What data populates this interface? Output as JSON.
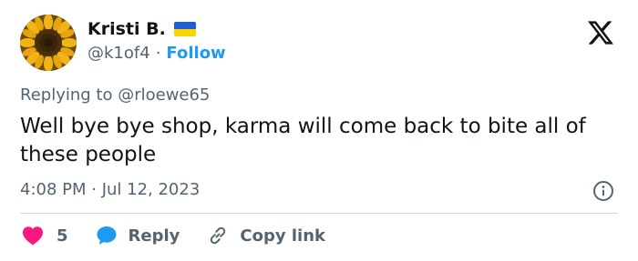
{
  "author": {
    "name": "Kristi B.",
    "handle": "@k1of4",
    "separator": "·",
    "follow_label": "Follow",
    "flag": {
      "top_color": "#1f5fd1",
      "bottom_color": "#ffd400"
    }
  },
  "brand_icon": "x-logo-icon",
  "tweet": {
    "replying_to": "Replying to @rloewe65",
    "text": "Well bye bye shop, karma will come back to bite all of these people",
    "timestamp": "4:08 PM · Jul 12, 2023"
  },
  "actions": {
    "likes_count": "5",
    "reply_label": "Reply",
    "copy_link_label": "Copy link"
  },
  "colors": {
    "accent": "#1d9bf0",
    "like": "#f91880",
    "text_primary": "#0f1419",
    "text_secondary": "#536471",
    "divider": "#cfd9de"
  }
}
